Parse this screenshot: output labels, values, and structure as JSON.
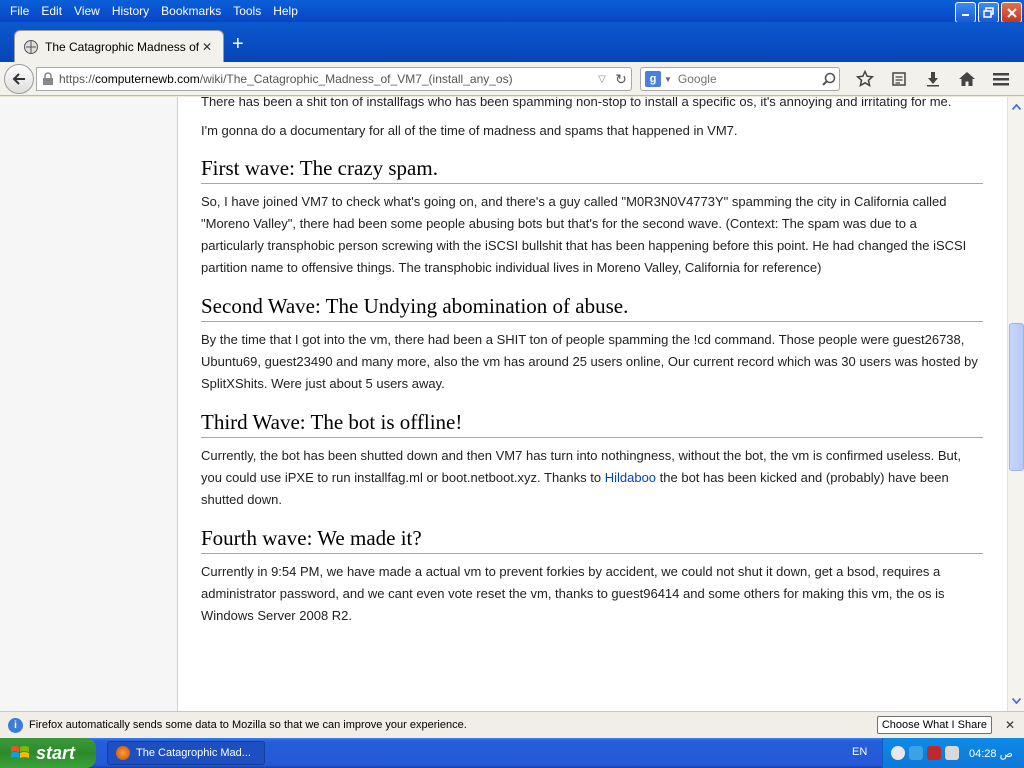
{
  "menubar": {
    "items": [
      "File",
      "Edit",
      "View",
      "History",
      "Bookmarks",
      "Tools",
      "Help"
    ]
  },
  "tab": {
    "title": "The Catagrophic Madness of ..."
  },
  "navbar": {
    "url_prefix": "https://",
    "url_domain": "computernewb.com",
    "url_path": "/wiki/The_Catagrophic_Madness_of_VM7_(install_any_os)",
    "search_engine_letter": "g",
    "search_placeholder": "Google"
  },
  "article": {
    "intro_1": "There has been a shit ton of installfags who has been spamming non-stop to install a specific os, it's annoying and irritating for me.",
    "intro_2": "I'm gonna do a documentary for all of the time of madness and spams that happened in VM7.",
    "sections": [
      {
        "heading": "First wave: The crazy spam.",
        "body": "So, I have joined VM7 to check what's going on, and there's a guy called \"M0R3N0V4773Y\" spamming the city in California called \"Moreno Valley\", there had been some people abusing bots but that's for the second wave. (Context: The spam was due to a particularly transphobic person screwing with the iSCSI bullshit that has been happening before this point. He had changed the iSCSI partition name to offensive things. The transphobic individual lives in Moreno Valley, California for reference)"
      },
      {
        "heading": "Second Wave: The Undying abomination of abuse.",
        "body": "By the time that I got into the vm, there had been a SHIT ton of people spamming the !cd command. Those people were guest26738, Ubuntu69, guest23490 and many more, also the vm has around 25 users online, Our current record which was 30 users was hosted by SplitXShits. Were just about 5 users away."
      },
      {
        "heading": "Third Wave: The bot is offline!",
        "body_before": "Currently, the bot has been shutted down and then VM7 has turn into nothingness, without the bot, the vm is confirmed useless. But, you could use iPXE to run installfag.ml or boot.netboot.xyz. Thanks to ",
        "link": "Hildaboo",
        "body_after": " the bot has been kicked and (probably) have been shutted down."
      },
      {
        "heading": "Fourth wave: We made it?",
        "body": "Currently in 9:54 PM, we have made a actual vm to prevent forkies by accident, we could not shut it down, get a bsod, requires a administrator password, and we cant even vote reset the vm, thanks to guest96414 and some others for making this vm, the os is Windows Server 2008 R2."
      }
    ]
  },
  "notification": {
    "text": "Firefox automatically sends some data to Mozilla so that we can improve your experience.",
    "button": "Choose What I Share"
  },
  "taskbar": {
    "start_label": "start",
    "task_title": "The Catagrophic Mad...",
    "language": "EN",
    "clock": "ص 04:28"
  }
}
